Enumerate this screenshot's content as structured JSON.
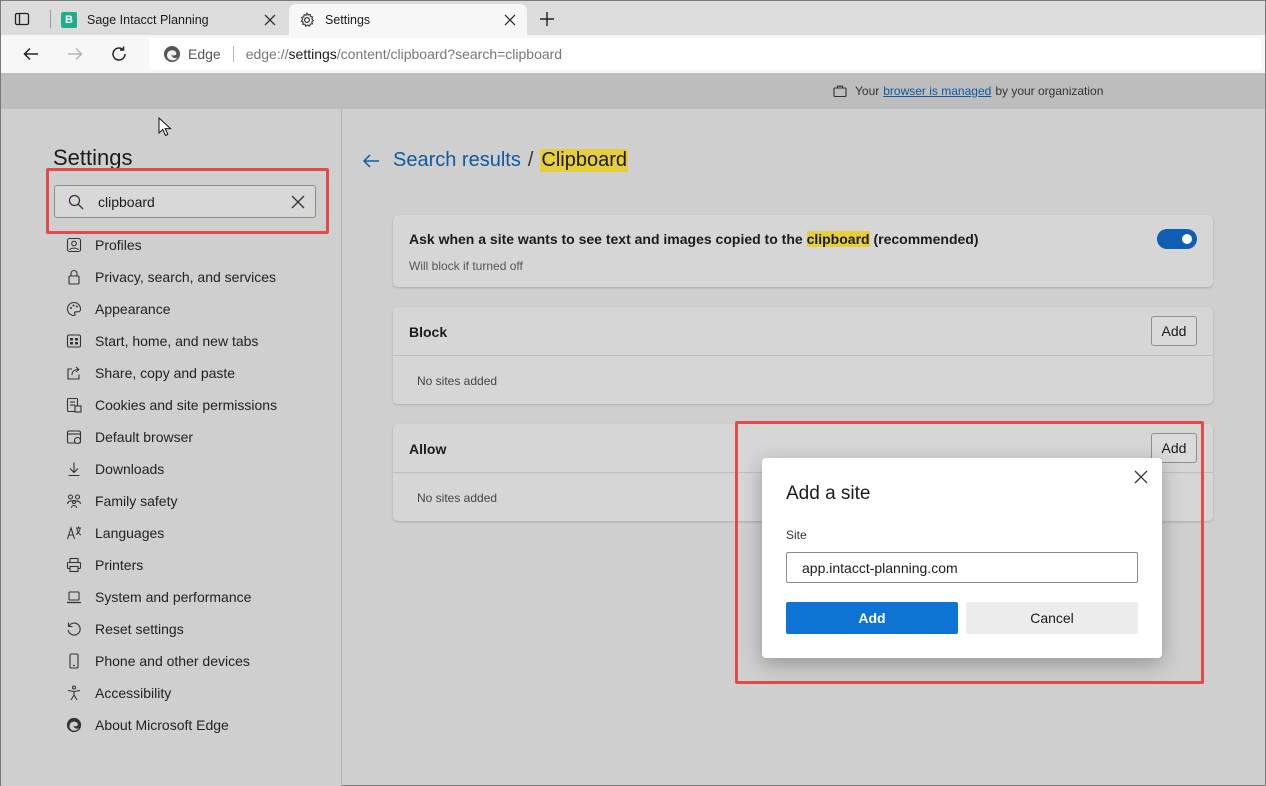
{
  "tabs": [
    {
      "title": "Sage Intacct Planning",
      "favicon": "B",
      "active": false
    },
    {
      "title": "Settings",
      "active": true
    }
  ],
  "address_bar": {
    "browser_name": "Edge",
    "url_scheme": "edge://",
    "url_host": "settings",
    "url_rest": "/content/clipboard?search=clipboard"
  },
  "managed_notice": {
    "prefix": "Your",
    "link": "browser is managed",
    "suffix": "by your organization"
  },
  "sidebar": {
    "title": "Settings",
    "search_value": "clipboard",
    "items": [
      {
        "label": "Profiles",
        "icon": "profile-icon"
      },
      {
        "label": "Privacy, search, and services",
        "icon": "lock-icon"
      },
      {
        "label": "Appearance",
        "icon": "palette-icon"
      },
      {
        "label": "Start, home, and new tabs",
        "icon": "home-tabs-icon"
      },
      {
        "label": "Share, copy and paste",
        "icon": "share-icon"
      },
      {
        "label": "Cookies and site permissions",
        "icon": "cookies-icon"
      },
      {
        "label": "Default browser",
        "icon": "browser-icon"
      },
      {
        "label": "Downloads",
        "icon": "download-icon"
      },
      {
        "label": "Family safety",
        "icon": "family-icon"
      },
      {
        "label": "Languages",
        "icon": "language-icon"
      },
      {
        "label": "Printers",
        "icon": "printer-icon"
      },
      {
        "label": "System and performance",
        "icon": "laptop-icon"
      },
      {
        "label": "Reset settings",
        "icon": "reset-icon"
      },
      {
        "label": "Phone and other devices",
        "icon": "phone-icon"
      },
      {
        "label": "Accessibility",
        "icon": "accessibility-icon"
      },
      {
        "label": "About Microsoft Edge",
        "icon": "edge-icon"
      }
    ]
  },
  "breadcrumb": {
    "parent": "Search results",
    "separator": "/",
    "current": "Clipboard"
  },
  "clipboard_setting": {
    "title_before": "Ask when a site wants to see text and images copied to the",
    "title_highlight": "clipboard",
    "title_after": "(recommended)",
    "subtitle": "Will block if turned off",
    "toggle_on": true
  },
  "block_section": {
    "title": "Block",
    "add_label": "Add",
    "empty_text": "No sites added"
  },
  "allow_section": {
    "title": "Allow",
    "add_label": "Add",
    "empty_text": "No sites added"
  },
  "dialog": {
    "title": "Add a site",
    "field_label": "Site",
    "field_value": "app.intacct-planning.com",
    "add_label": "Add",
    "cancel_label": "Cancel"
  },
  "colors": {
    "accent": "#0e74d3",
    "highlight_box": "#e34a4a",
    "search_highlight": "#e6cf3a"
  }
}
